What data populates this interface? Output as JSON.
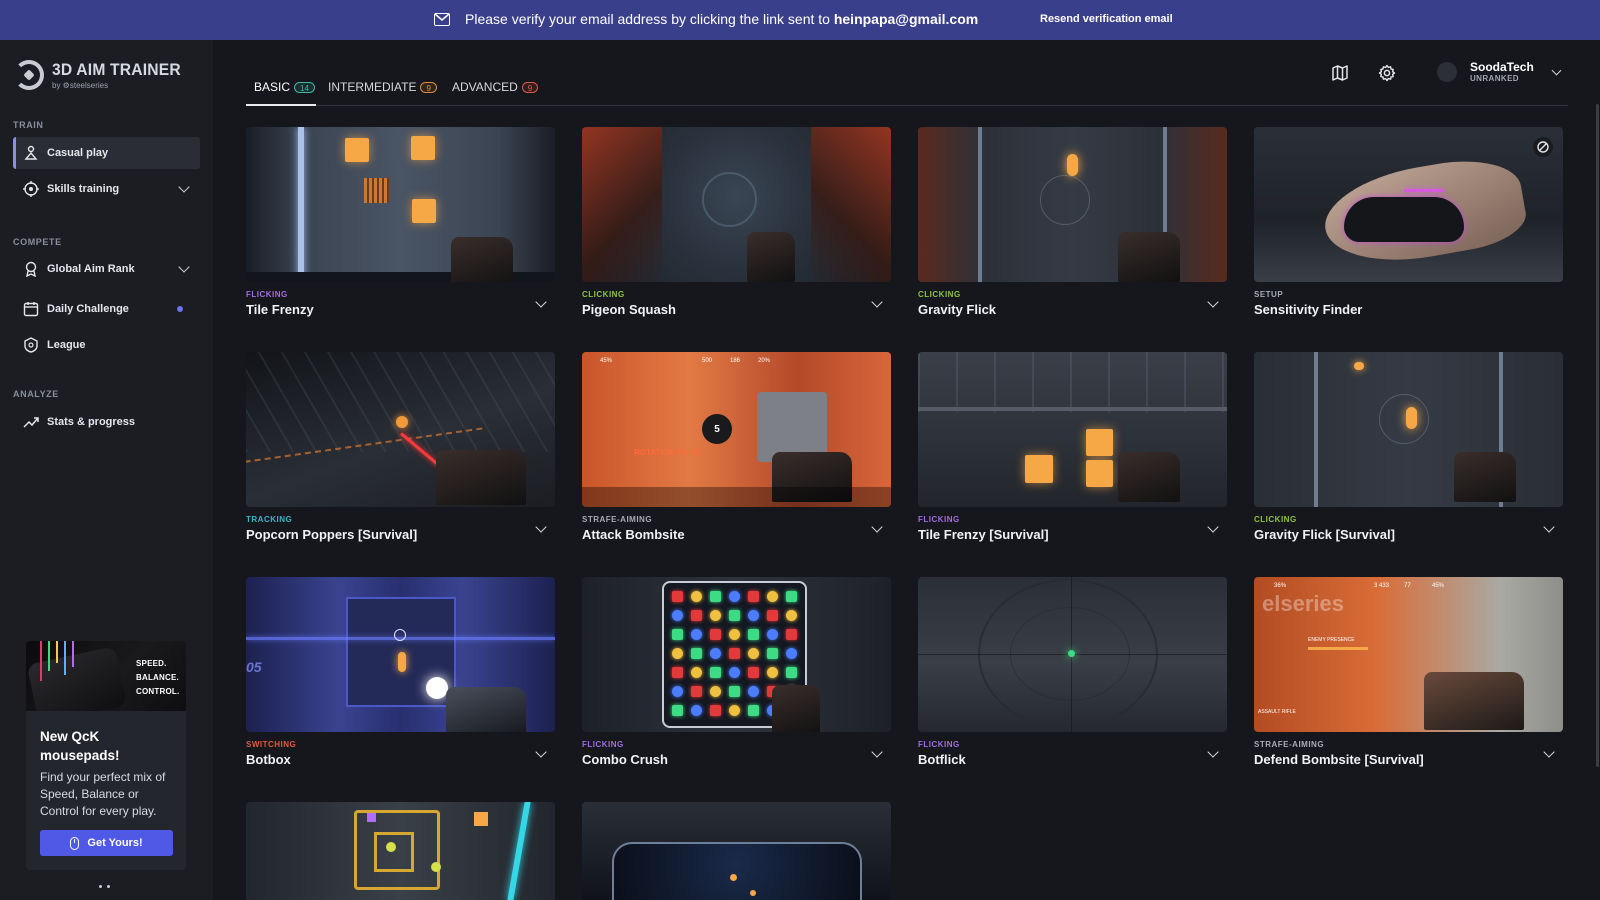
{
  "banner": {
    "message": "Please verify your email address by clicking the link sent to ",
    "email": "heinpapa@gmail.com",
    "resend": "Resend verification email"
  },
  "logo": {
    "name": "3D AIM TRAINER",
    "by": "by ⚙steelseries"
  },
  "sidebar": {
    "sections": [
      "TRAIN",
      "COMPETE",
      "ANALYZE"
    ],
    "items": [
      {
        "label": "Casual play",
        "icon": "casual-play-icon"
      },
      {
        "label": "Skills training",
        "icon": "crosshair-icon"
      },
      {
        "label": "Global Aim Rank",
        "icon": "rank-icon"
      },
      {
        "label": "Daily Challenge",
        "icon": "calendar-icon"
      },
      {
        "label": "League",
        "icon": "shield-icon"
      },
      {
        "label": "Stats & progress",
        "icon": "trend-up-icon"
      }
    ]
  },
  "promo": {
    "tags": [
      "SPEED.",
      "BALANCE.",
      "CONTROL."
    ],
    "title": "New QcK mousepads!",
    "desc": "Find your perfect mix of Speed, Balance or Control for every play.",
    "button": "Get Yours!"
  },
  "tabs": [
    {
      "label": "BASIC",
      "count": "14"
    },
    {
      "label": "INTERMEDIATE",
      "count": "9"
    },
    {
      "label": "ADVANCED",
      "count": "9"
    }
  ],
  "user": {
    "name": "SoodaTech",
    "rank": "UNRANKED"
  },
  "cards": [
    {
      "category": "FLICKING",
      "name": "Tile Frenzy"
    },
    {
      "category": "CLICKING",
      "name": "Pigeon Squash"
    },
    {
      "category": "CLICKING",
      "name": "Gravity Flick"
    },
    {
      "category": "SETUP",
      "name": "Sensitivity Finder"
    },
    {
      "category": "TRACKING",
      "name": "Popcorn Poppers [Survival]"
    },
    {
      "category": "STRAFE-AIMING",
      "name": "Attack Bombsite"
    },
    {
      "category": "FLICKING",
      "name": "Tile Frenzy [Survival]"
    },
    {
      "category": "CLICKING",
      "name": "Gravity Flick [Survival]"
    },
    {
      "category": "SWITCHING",
      "name": "Botbox"
    },
    {
      "category": "FLICKING",
      "name": "Combo Crush"
    },
    {
      "category": "FLICKING",
      "name": "Botflick"
    },
    {
      "category": "STRAFE-AIMING",
      "name": "Defend Bombsite [Survival]"
    }
  ],
  "thumb_text": {
    "rotation_point": "ROTATION POINT",
    "countdown": "5",
    "hud_45": "45%",
    "hud_500": "500",
    "hud_186": "186",
    "hud_20": "20%",
    "lane": "05",
    "brand_wall": "elseries",
    "enemy_presence": "ENEMY PRESENCE",
    "hud_36": "36%",
    "hud_3433": "3 433",
    "hud_77": "77",
    "hud_45b": "45%",
    "assault_rifle": "ASSAULT RIFLE"
  },
  "colors": {
    "banner": "#3a3f8c",
    "accent": "#5058e6",
    "flicking": "#a46be6",
    "clicking": "#8cc43a",
    "tracking": "#36b6c8",
    "switching": "#e45a3c"
  }
}
